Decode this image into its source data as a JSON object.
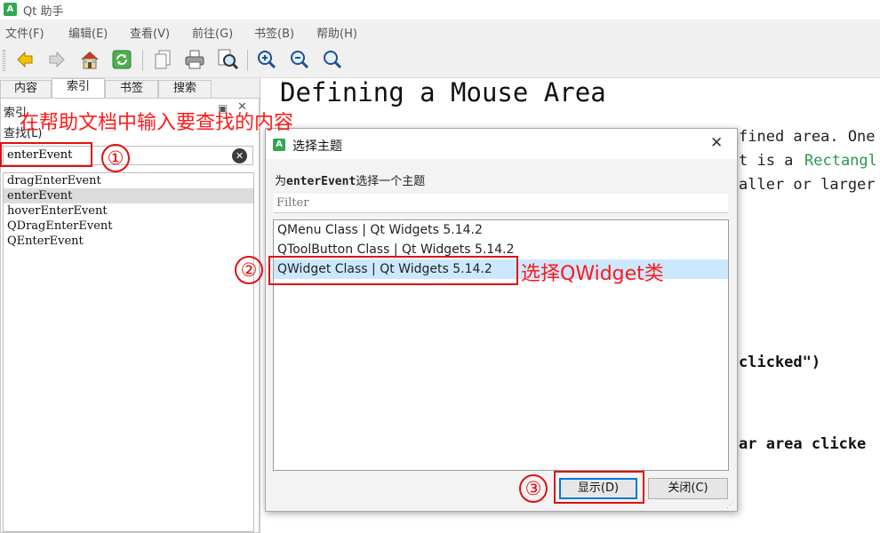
{
  "window": {
    "title": "Qt 助手",
    "app_icon": "A"
  },
  "menu": {
    "file": "文件(F)",
    "edit": "编辑(E)",
    "view": "查看(V)",
    "go": "前往(G)",
    "bookmarks": "书签(B)",
    "help": "帮助(H)"
  },
  "toolbar": {
    "icons": [
      "arrow-left-icon",
      "arrow-right-icon",
      "home-icon",
      "sync-icon",
      "copy-page-icon",
      "print-icon",
      "find-icon",
      "zoom-in-icon",
      "zoom-out-icon",
      "zoom-reset-icon"
    ]
  },
  "left_panel": {
    "tabs": [
      "内容",
      "索引",
      "书签",
      "搜索"
    ],
    "active_tab": "索引",
    "panel_title": "索引",
    "float_glyph": "▣",
    "close_glyph": "✕",
    "find_label": "查找(L)",
    "search_value": "enterEvent",
    "clear_glyph": "✕",
    "results": [
      "dragEnterEvent",
      "enterEvent",
      "hoverEnterEvent",
      "QDragEnterEvent",
      "QEnterEvent"
    ],
    "selected_result": "enterEvent"
  },
  "content": {
    "title": "Defining a Mouse Area",
    "fragments": [
      "fined area. One",
      "t is a",
      "Rectangl",
      "aller or larger",
      "clicked\")",
      "ar area clicke"
    ]
  },
  "dialog": {
    "title": "选择主题",
    "close_glyph": "✕",
    "prompt_prefix": "为",
    "prompt_keyword": "enterEvent",
    "prompt_suffix": "选择一个主题",
    "filter_placeholder": "Filter",
    "topics": [
      "QMenu Class | Qt Widgets 5.14.2",
      "QToolButton Class | Qt Widgets 5.14.2",
      "QWidget Class | Qt Widgets 5.14.2"
    ],
    "selected_topic": "QWidget Class | Qt Widgets 5.14.2",
    "show_button": "显示(D)",
    "close_button": "关闭(C)"
  },
  "annotations": {
    "step1_text": "在帮助文档中输入要查找的内容",
    "step1_num": "①",
    "step2_text": "选择QWidget类",
    "step2_num": "②",
    "step3_num": "③",
    "color": "#ff1a1a"
  }
}
